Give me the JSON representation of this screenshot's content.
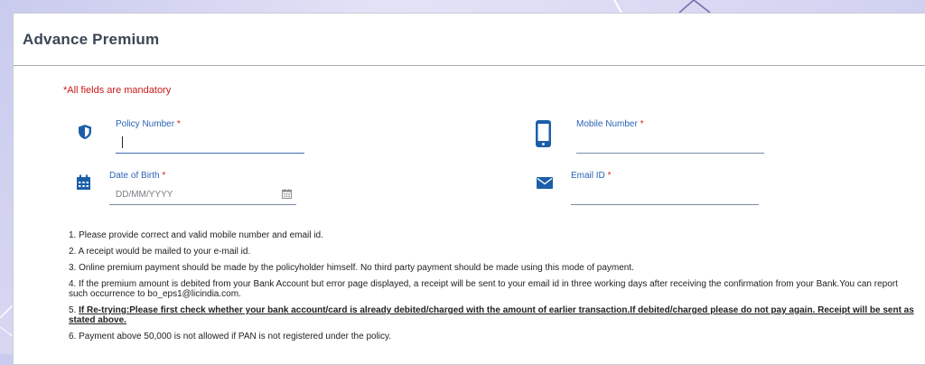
{
  "page": {
    "title": "Advance Premium"
  },
  "form": {
    "mandatory_note": "*All fields are mandatory",
    "required_mark": "*",
    "policy_number": {
      "label": "Policy Number",
      "value": ""
    },
    "mobile_number": {
      "label": "Mobile Number",
      "value": ""
    },
    "date_of_birth": {
      "label": "Date of Birth",
      "placeholder": "DD/MM/YYYY"
    },
    "email_id": {
      "label": "Email ID",
      "value": ""
    }
  },
  "icons": {
    "policy": "shield-icon",
    "mobile": "mobile-phone-icon",
    "dob": "calendar-icon",
    "dob_picker": "calendar-small-icon",
    "email": "envelope-icon"
  },
  "colors": {
    "accent": "#1c5fa8",
    "label": "#2b63b6",
    "required": "#d22222"
  },
  "notes": [
    "1. Please provide correct and valid mobile number and email id.",
    "2. A receipt would be mailed to your e-mail id.",
    "3. Online premium payment should be made by the policyholder himself. No third party payment should be made using this mode of payment.",
    "4. If the premium amount is debited from your Bank Account but error page displayed, a receipt will be sent to your email id in three working days after receiving the confirmation from your Bank.You can report such occurrence to bo_eps1@licindia.com.",
    {
      "prefix": "5. ",
      "bold": "If Re-trying:Please first check whether your bank account/card is already debited/charged with the amount of earlier transaction.If debited/charged please do not pay again. Receipt will be sent as stated above."
    },
    "6. Payment above 50,000 is not allowed if PAN is not registered under the policy."
  ]
}
